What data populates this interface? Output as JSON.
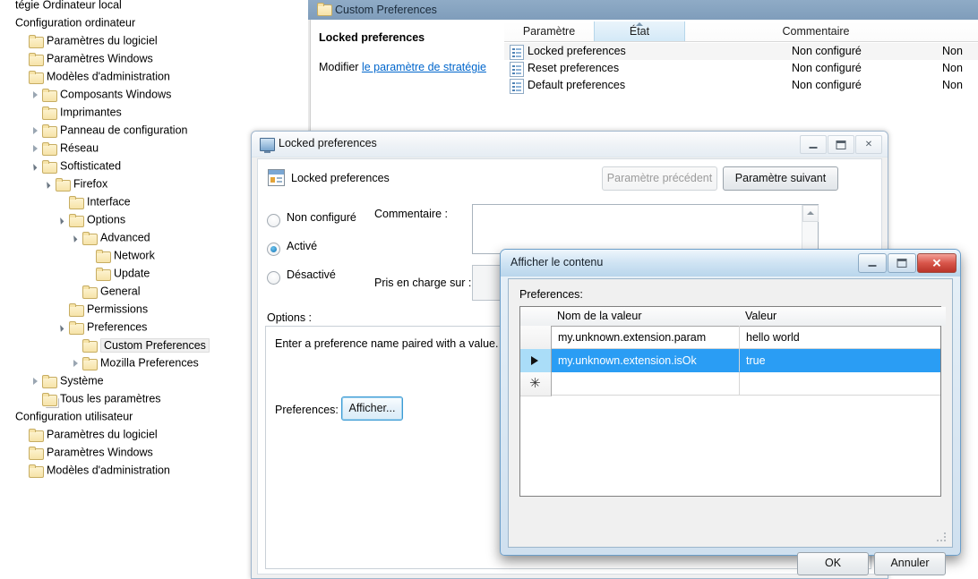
{
  "tree": {
    "items": [
      {
        "label": "tégie Ordinateur local",
        "indent": 0,
        "arrow": "none",
        "icon": "none",
        "clipped": true
      },
      {
        "label": "Configuration ordinateur",
        "indent": 0,
        "arrow": "none",
        "icon": "none"
      },
      {
        "label": "Paramètres du logiciel",
        "indent": 1,
        "arrow": "none",
        "icon": "folder"
      },
      {
        "label": "Paramètres Windows",
        "indent": 1,
        "arrow": "none",
        "icon": "folder"
      },
      {
        "label": "Modèles d'administration",
        "indent": 1,
        "arrow": "none",
        "icon": "folder"
      },
      {
        "label": "Composants Windows",
        "indent": 2,
        "arrow": "closed",
        "icon": "folder"
      },
      {
        "label": "Imprimantes",
        "indent": 2,
        "arrow": "none",
        "icon": "folder"
      },
      {
        "label": "Panneau de configuration",
        "indent": 2,
        "arrow": "closed",
        "icon": "folder"
      },
      {
        "label": "Réseau",
        "indent": 2,
        "arrow": "closed",
        "icon": "folder"
      },
      {
        "label": "Softisticated",
        "indent": 2,
        "arrow": "open",
        "icon": "folder"
      },
      {
        "label": "Firefox",
        "indent": 3,
        "arrow": "open",
        "icon": "folder"
      },
      {
        "label": "Interface",
        "indent": 4,
        "arrow": "none",
        "icon": "folder"
      },
      {
        "label": "Options",
        "indent": 4,
        "arrow": "open",
        "icon": "folder"
      },
      {
        "label": "Advanced",
        "indent": 5,
        "arrow": "open",
        "icon": "folder"
      },
      {
        "label": "Network",
        "indent": 6,
        "arrow": "none",
        "icon": "folder"
      },
      {
        "label": "Update",
        "indent": 6,
        "arrow": "none",
        "icon": "folder"
      },
      {
        "label": "General",
        "indent": 5,
        "arrow": "none",
        "icon": "folder"
      },
      {
        "label": "Permissions",
        "indent": 4,
        "arrow": "none",
        "icon": "folder"
      },
      {
        "label": "Preferences",
        "indent": 4,
        "arrow": "open",
        "icon": "folder"
      },
      {
        "label": "Custom Preferences",
        "indent": 5,
        "arrow": "none",
        "icon": "folder",
        "selected": true
      },
      {
        "label": "Mozilla Preferences",
        "indent": 5,
        "arrow": "closed",
        "icon": "folder"
      },
      {
        "label": "Système",
        "indent": 2,
        "arrow": "closed",
        "icon": "folder"
      },
      {
        "label": "Tous les paramètres",
        "indent": 2,
        "arrow": "none",
        "icon": "multi"
      },
      {
        "label": "Configuration utilisateur",
        "indent": 0,
        "arrow": "none",
        "icon": "none"
      },
      {
        "label": "Paramètres du logiciel",
        "indent": 1,
        "arrow": "none",
        "icon": "folder"
      },
      {
        "label": "Paramètres Windows",
        "indent": 1,
        "arrow": "none",
        "icon": "folder"
      },
      {
        "label": "Modèles d'administration",
        "indent": 1,
        "arrow": "none",
        "icon": "folder"
      }
    ]
  },
  "selected_node": {
    "label": "Custom Preferences"
  },
  "extended_panel": {
    "setting_title": "Locked preferences",
    "edit_prefix": "Modifier",
    "edit_link": "le paramètre de stratégie"
  },
  "settings_list": {
    "columns": [
      {
        "label": "Paramètre",
        "sorted": false
      },
      {
        "label": "État",
        "sorted": true
      },
      {
        "label": "Commentaire",
        "sorted": false
      }
    ],
    "rows": [
      {
        "name": "Locked preferences",
        "state": "Non configuré",
        "comment": "Non"
      },
      {
        "name": "Reset preferences",
        "state": "Non configuré",
        "comment": "Non"
      },
      {
        "name": "Default preferences",
        "state": "Non configuré",
        "comment": "Non"
      }
    ]
  },
  "window_locked": {
    "title": "Locked preferences",
    "setting_name": "Locked preferences",
    "prev_button": "Paramètre précédent",
    "next_button": "Paramètre suivant",
    "minimize_title": "Réduire",
    "maximize_title": "Agrandir",
    "close_glyph": "✕",
    "radios": [
      {
        "label": "Non configuré",
        "checked": false
      },
      {
        "label": "Activé",
        "checked": true
      },
      {
        "label": "Désactivé",
        "checked": false
      }
    ],
    "comment_label": "Commentaire :",
    "comment_value": "",
    "supported_label": "Pris en charge sur :",
    "supported_value": "",
    "options_label": "Options :",
    "help_text": "Enter a preference name paired with a value.",
    "preferences_label": "Preferences:",
    "show_button": "Afficher..."
  },
  "window_content": {
    "title": "Afficher le contenu",
    "close_glyph": "✕",
    "preferences_label": "Preferences:",
    "grid": {
      "columns": [
        "Nom de la valeur",
        "Valeur"
      ],
      "rows": [
        {
          "name": "my.unknown.extension.param",
          "value": "hello world",
          "selected": false,
          "marker": ""
        },
        {
          "name": "my.unknown.extension.isOk",
          "value": "true",
          "selected": true,
          "marker": "arrow"
        },
        {
          "name": "",
          "value": "",
          "selected": false,
          "marker": "star"
        }
      ]
    },
    "ok_button": "OK",
    "cancel_button": "Annuler"
  },
  "colors": {
    "selection_blue": "#2a9df4",
    "row_header_blue": "#aaddf8",
    "selbar_blue": "#8fabc6",
    "link_blue": "#0066cc",
    "close_red": "#d8554a"
  }
}
